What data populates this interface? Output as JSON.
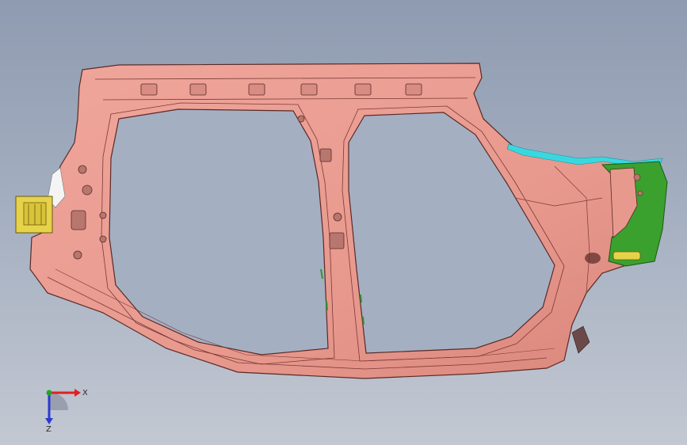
{
  "viewport": {
    "background_top": "#8f9bb0",
    "background_bottom": "#c3c8d2"
  },
  "model": {
    "part_color": "#e8998e",
    "part_edge": "#5a2a26",
    "bracket_yellow": "#e6d34a",
    "bracket_green": "#3aa02e",
    "flange_cyan": "#39d8e0"
  },
  "triad": {
    "x_label": "X",
    "z_label": "Z",
    "x_color": "#e02020",
    "z_color": "#2a3ad0",
    "origin_color": "#2aa02a"
  }
}
